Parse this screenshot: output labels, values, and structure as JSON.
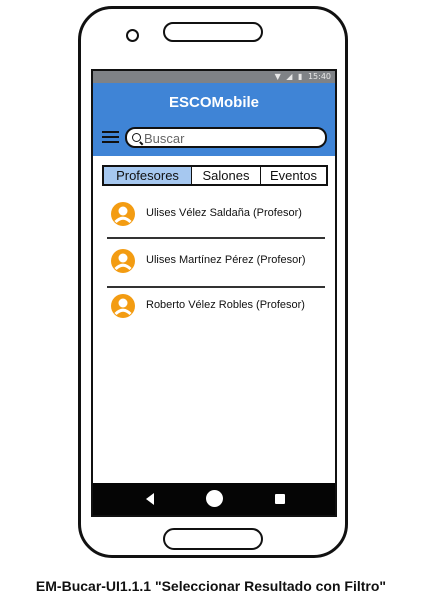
{
  "status_bar": {
    "icons": [
      "wifi-icon",
      "signal-icon",
      "battery-icon"
    ],
    "time": "15:40"
  },
  "app_bar": {
    "title": "ESCOMobile",
    "color": "#3f84d6"
  },
  "search": {
    "placeholder": "Buscar"
  },
  "tabs": [
    {
      "label": "Profesores",
      "active": true
    },
    {
      "label": "Salones",
      "active": false
    },
    {
      "label": "Eventos",
      "active": false
    }
  ],
  "results": [
    {
      "label": "Ulises Vélez Saldaña (Profesor)",
      "icon": "user-icon"
    },
    {
      "label": "Ulises Martínez Pérez (Profesor)",
      "icon": "user-icon"
    },
    {
      "label": "Roberto Vélez Robles (Profesor)",
      "icon": "user-icon"
    }
  ],
  "accent_color": "#f39c12",
  "nav_bar": {
    "buttons": [
      "back-icon",
      "home-icon",
      "recent-apps-icon"
    ]
  },
  "caption": "EM-Bucar-UI1.1.1 \"Seleccionar Resultado con Filtro\""
}
